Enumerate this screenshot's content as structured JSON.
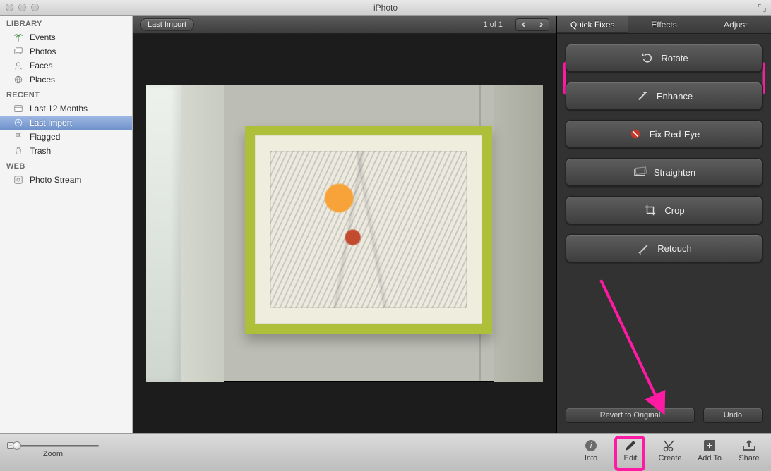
{
  "window": {
    "title": "iPhoto"
  },
  "sidebar": {
    "sections": [
      {
        "title": "LIBRARY",
        "items": [
          {
            "label": "Events",
            "icon": "palm-icon"
          },
          {
            "label": "Photos",
            "icon": "photos-icon"
          },
          {
            "label": "Faces",
            "icon": "face-icon"
          },
          {
            "label": "Places",
            "icon": "globe-icon"
          }
        ]
      },
      {
        "title": "RECENT",
        "items": [
          {
            "label": "Last 12 Months",
            "icon": "calendar-icon"
          },
          {
            "label": "Last Import",
            "icon": "import-icon",
            "selected": true
          },
          {
            "label": "Flagged",
            "icon": "flag-icon"
          },
          {
            "label": "Trash",
            "icon": "trash-icon"
          }
        ]
      },
      {
        "title": "WEB",
        "items": [
          {
            "label": "Photo Stream",
            "icon": "stream-icon"
          }
        ]
      }
    ]
  },
  "viewer": {
    "title_chip": "Last Import",
    "counter": "1 of 1"
  },
  "panel": {
    "tabs": [
      "Quick Fixes",
      "Effects",
      "Adjust"
    ],
    "active_tab": 0,
    "buttons": [
      {
        "label": "Rotate",
        "icon": "rotate-icon"
      },
      {
        "label": "Enhance",
        "icon": "wand-icon"
      },
      {
        "label": "Fix Red-Eye",
        "icon": "redeye-icon"
      },
      {
        "label": "Straighten",
        "icon": "straighten-icon"
      },
      {
        "label": "Crop",
        "icon": "crop-icon"
      },
      {
        "label": "Retouch",
        "icon": "brush-icon"
      }
    ],
    "revert_label": "Revert to Original",
    "undo_label": "Undo"
  },
  "toolbar": {
    "zoom_label": "Zoom",
    "items": [
      {
        "label": "Info",
        "icon": "info-icon"
      },
      {
        "label": "Edit",
        "icon": "pencil-icon",
        "selected": true
      },
      {
        "label": "Create",
        "icon": "scissors-icon"
      },
      {
        "label": "Add To",
        "icon": "plus-icon"
      },
      {
        "label": "Share",
        "icon": "share-icon"
      }
    ]
  }
}
